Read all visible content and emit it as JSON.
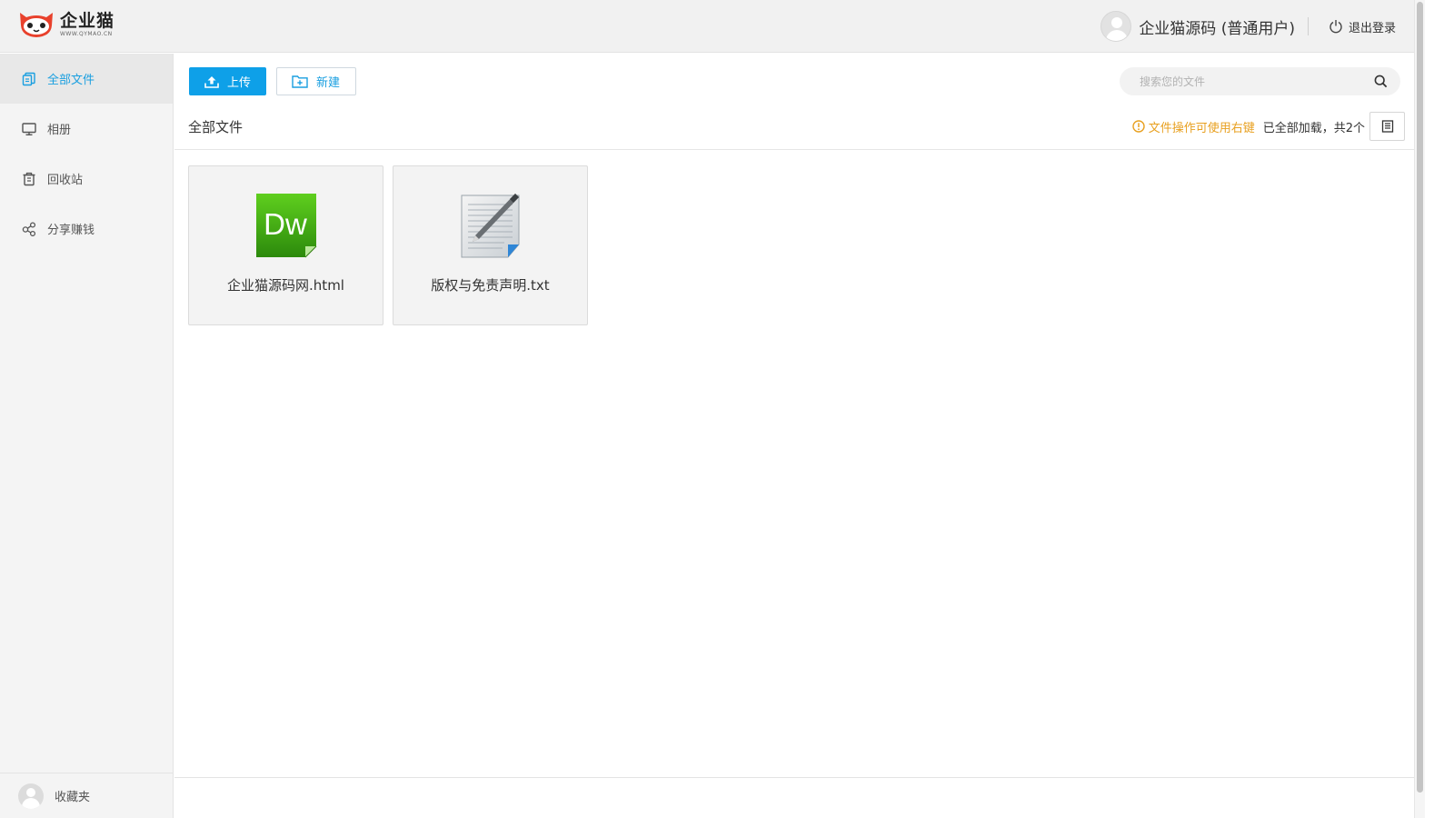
{
  "header": {
    "logo_name": "企业猫",
    "logo_url": "WWW.QYMAO.CN",
    "user_name": "企业猫源码 (普通用户)",
    "logout_label": "退出登录"
  },
  "sidebar": {
    "items": [
      {
        "label": "全部文件",
        "icon": "files-icon",
        "active": true
      },
      {
        "label": "相册",
        "icon": "monitor-icon",
        "active": false
      },
      {
        "label": "回收站",
        "icon": "trash-icon",
        "active": false
      },
      {
        "label": "分享赚钱",
        "icon": "share-icon",
        "active": false
      }
    ],
    "bottom_label": "收藏夹"
  },
  "toolbar": {
    "upload_label": "上传",
    "new_label": "新建"
  },
  "search": {
    "placeholder": "搜索您的文件"
  },
  "breadcrumb": {
    "current": "全部文件"
  },
  "status": {
    "tip": "文件操作可使用右键",
    "loaded": "已全部加载，共2个"
  },
  "files": [
    {
      "name": "企业猫源码网.html",
      "icon": "dreamweaver-icon"
    },
    {
      "name": "版权与免责声明.txt",
      "icon": "text-document-icon"
    }
  ],
  "colors": {
    "accent": "#0ea0e8",
    "tip": "#e8a020",
    "header_bg": "#f1f1f1",
    "sidebar_bg": "#f4f4f4"
  }
}
